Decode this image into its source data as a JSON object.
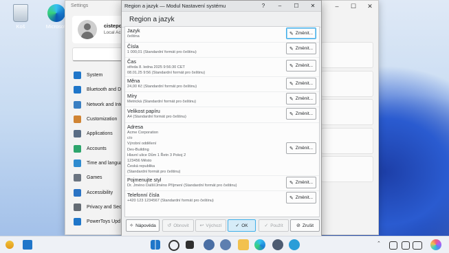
{
  "desktop": {
    "icons": [
      {
        "label": "Koš"
      },
      {
        "label": "Microsoft"
      }
    ]
  },
  "settings": {
    "window_title": "Settings",
    "user_name": "cistepc",
    "account": "Local Ac",
    "nav": [
      {
        "label": "System",
        "color": "#1f76c9"
      },
      {
        "label": "Bluetooth and De",
        "color": "#1f76c9"
      },
      {
        "label": "Network and Inte",
        "color": "#3a7fc2"
      },
      {
        "label": "Customization",
        "color": "#d08433"
      },
      {
        "label": "Applications",
        "color": "#5a6d85"
      },
      {
        "label": "Accounts",
        "color": "#2da56c"
      },
      {
        "label": "Time and langua",
        "color": "#2f8bcf"
      },
      {
        "label": "Games",
        "color": "#6b7480"
      },
      {
        "label": "Accessibility",
        "color": "#2a73c4"
      },
      {
        "label": "Privacy and Secu",
        "color": "#646b73"
      },
      {
        "label": "PowerToys Upd",
        "color": "#1f76c9"
      }
    ]
  },
  "dialog": {
    "title": "Region a jazyk — Modul Nastavení systému",
    "header": "Region a jazyk",
    "change_label": "Změnit...",
    "rows": [
      {
        "label": "Jazyk",
        "values": [
          "čeština"
        ]
      },
      {
        "label": "Čísla",
        "values": [
          "1 000,01 (Standardní formát pro češtinu)"
        ]
      },
      {
        "label": "Čas",
        "values": [
          "středa 8. ledna 2025 9:56:30 CET",
          "08.01.25 9:56 (Standardní formát pro češtinu)"
        ]
      },
      {
        "label": "Měna",
        "values": [
          "24,00 Kč (Standardní formát pro češtinu)"
        ]
      },
      {
        "label": "Míry",
        "values": [
          "Metrická (Standardní formát pro češtinu)"
        ]
      },
      {
        "label": "Velikost papíru",
        "values": [
          "A4 (Standardní formát pro češtinu)"
        ]
      },
      {
        "label": "Adresa",
        "values": [
          "Acme Corporation",
          "c/o",
          "Výrobní oddělení",
          "Dev-Building",
          "Hlavní ulice Dům 1 Řetn 3 Pokoj 2",
          "123456 Město",
          "Česká republika",
          "(Standardní formát pro češtinu)"
        ]
      },
      {
        "label": "Pojmenujte styl",
        "values": [
          "Dr. Jméno Další/Jméno Příjmení (Standardní formát pro češtinu)"
        ]
      },
      {
        "label": "Telefonní čísla",
        "values": [
          "+420 123 1234567 (Standardní formát pro češtinu)"
        ]
      }
    ],
    "footer": {
      "help": "Nápověda",
      "refresh": "Obnovit",
      "defaults": "Výchozí",
      "ok": "OK",
      "apply": "Použít",
      "cancel": "Zrušit"
    }
  },
  "taskbar": {
    "accent": "#1f76c9"
  }
}
